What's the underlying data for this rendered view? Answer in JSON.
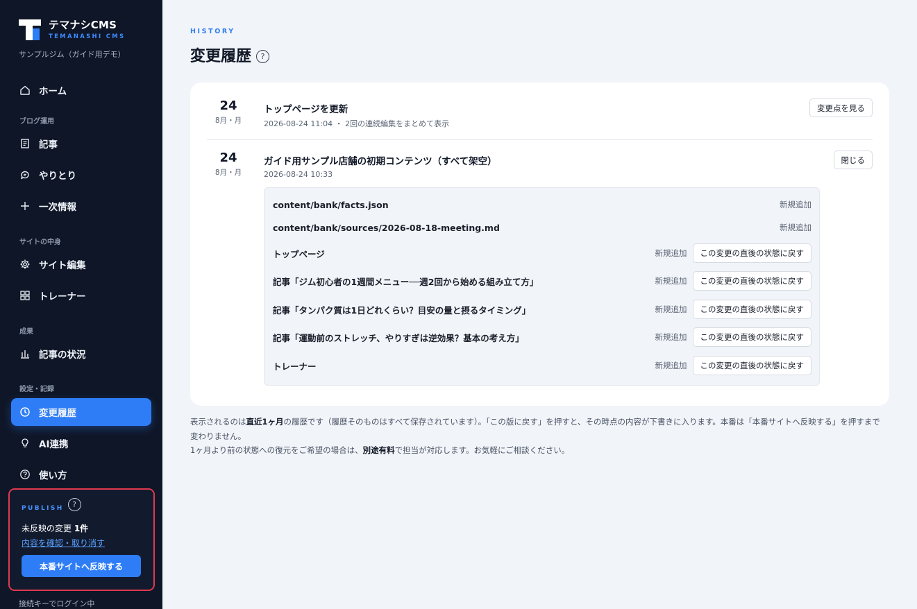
{
  "app": {
    "name": "テマナシCMS",
    "name_en": "TEMANASHI CMS",
    "site_name": "サンプルジム（ガイド用デモ）"
  },
  "sidebar": {
    "home": {
      "label": "ホーム",
      "icon": "home-icon"
    },
    "sections": {
      "blog": "ブログ運用",
      "site": "サイトの中身",
      "results": "成果",
      "settings": "設定・記録"
    },
    "items": {
      "articles": {
        "label": "記事",
        "icon": "document-icon"
      },
      "exchanges": {
        "label": "やりとり",
        "icon": "chat-icon"
      },
      "primary_info": {
        "label": "一次情報",
        "icon": "plus-icon"
      },
      "site_edit": {
        "label": "サイト編集",
        "icon": "gear-icon"
      },
      "trainers": {
        "label": "トレーナー",
        "icon": "grid-icon"
      },
      "article_status": {
        "label": "記事の状況",
        "icon": "bar-chart-icon"
      },
      "history": {
        "label": "変更履歴",
        "icon": "clock-icon",
        "active": true
      },
      "ai": {
        "label": "AI連携",
        "icon": "lightbulb-icon"
      },
      "howto": {
        "label": "使い方",
        "icon": "help-circle-icon"
      }
    },
    "publish": {
      "label": "PUBLISH",
      "pending_prefix": "未反映の変更 ",
      "pending_count": "1件",
      "review_link": "内容を確認・取り消す",
      "publish_button": "本番サイトへ反映する"
    },
    "login_note": "接続キーでログイン中"
  },
  "main": {
    "eyebrow": "HISTORY",
    "title": "変更履歴",
    "entries": [
      {
        "day": "24",
        "month": "8月・月",
        "title": "トップページを更新",
        "meta": "2026-08-24 11:04 ・ 2回の連続編集をまとめて表示",
        "action": "変更点を見る"
      },
      {
        "day": "24",
        "month": "8月・月",
        "title": "ガイド用サンプル店舗の初期コンテンツ（すべて架空）",
        "meta": "2026-08-24 10:33",
        "action": "閉じる",
        "changes": [
          {
            "name": "content/bank/facts.json",
            "status": "新規追加",
            "restore": ""
          },
          {
            "name": "content/bank/sources/2026-08-18-meeting.md",
            "status": "新規追加",
            "restore": ""
          },
          {
            "name": "トップページ",
            "status": "新規追加",
            "restore": "この変更の直後の状態に戻す"
          },
          {
            "name": "記事「ジム初心者の1週間メニュー──週2回から始める組み立て方」",
            "status": "新規追加",
            "restore": "この変更の直後の状態に戻す"
          },
          {
            "name": "記事「タンパク質は1日どれくらい？目安の量と摂るタイミング」",
            "status": "新規追加",
            "restore": "この変更の直後の状態に戻す"
          },
          {
            "name": "記事「運動前のストレッチ、やりすぎは逆効果？基本の考え方」",
            "status": "新規追加",
            "restore": "この変更の直後の状態に戻す"
          },
          {
            "name": "トレーナー",
            "status": "新規追加",
            "restore": "この変更の直後の状態に戻す"
          }
        ]
      }
    ],
    "footnote": {
      "p1_a": "表示されるのは",
      "p1_b": "直近1ヶ月",
      "p1_c": "の履歴です（履歴そのものはすべて保存されています）。「この版に戻す」を押すと、その時点の内容が下書きに入ります。本番は「本番サイトへ反映する」を押すまで変わりません。",
      "p2_a": "1ヶ月より前の状態への復元をご希望の場合は、",
      "p2_b": "別途有料",
      "p2_c": "で担当が対応します。お気軽にご相談ください。"
    }
  }
}
